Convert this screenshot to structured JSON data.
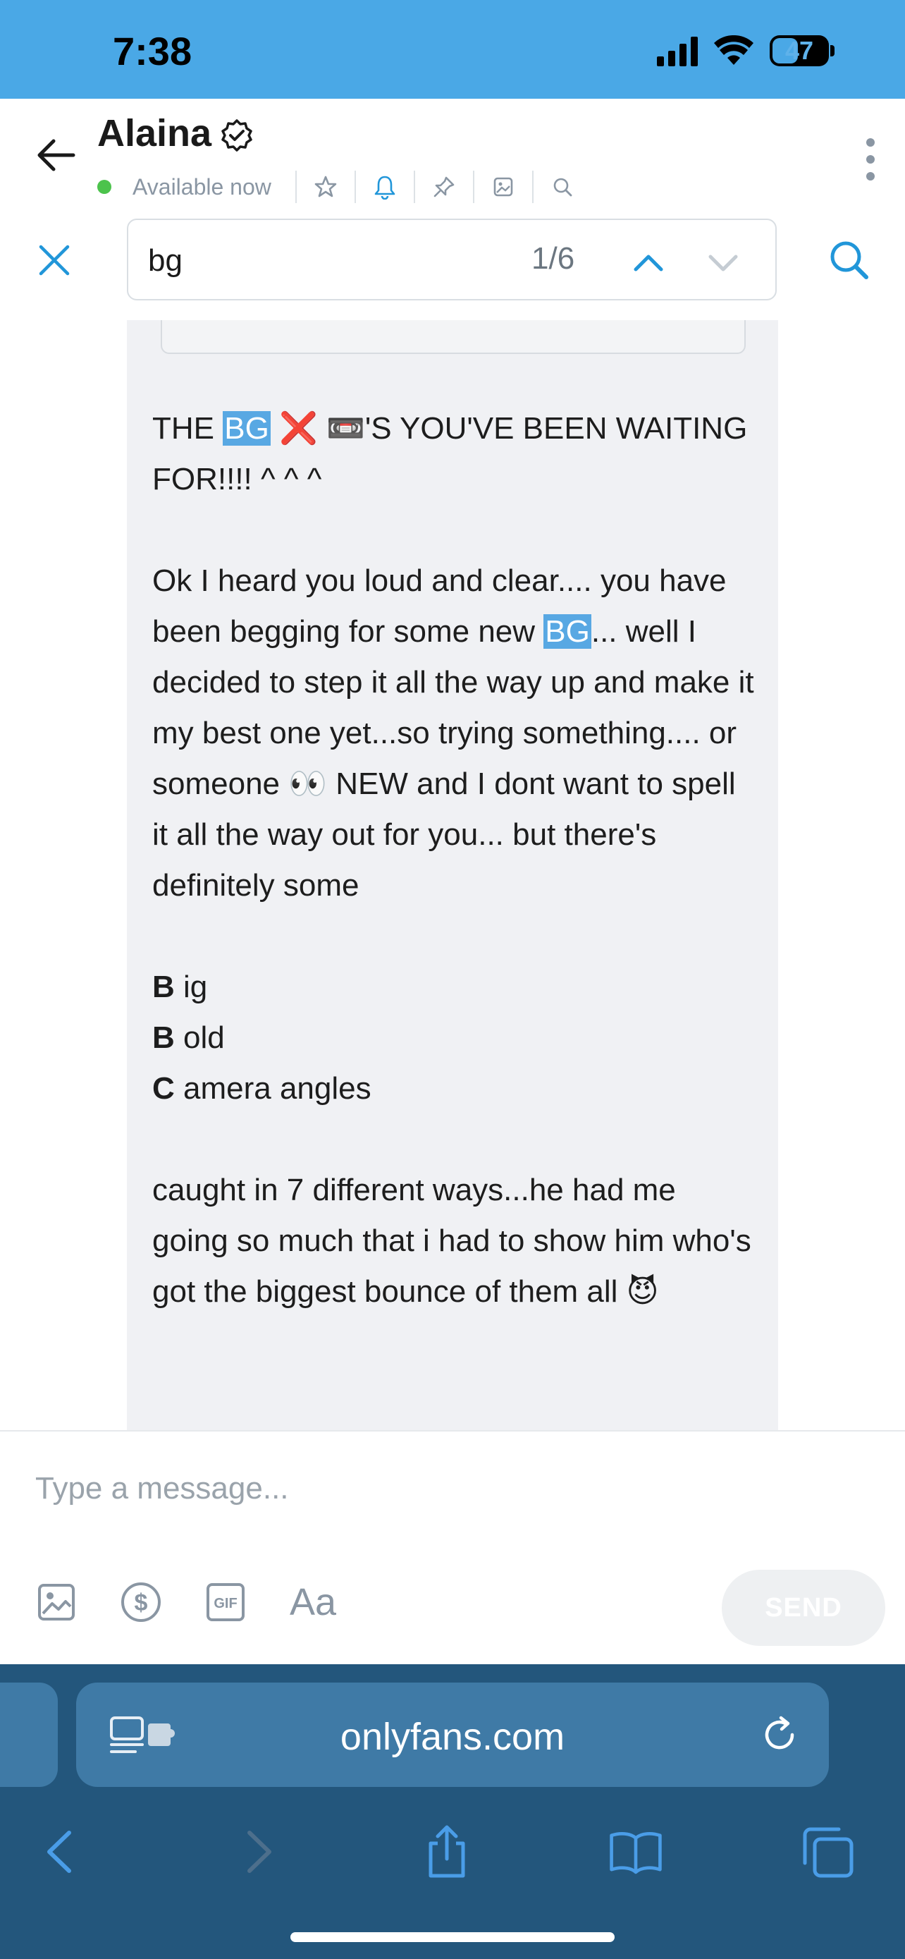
{
  "status_bar": {
    "time": "7:38",
    "battery": "47"
  },
  "header": {
    "contact_name": "Alaina",
    "presence": "Available now",
    "icons": [
      "star-icon",
      "bell-icon",
      "pin-icon",
      "image-icon",
      "search-icon"
    ]
  },
  "search": {
    "query": "bg",
    "count": "1/6"
  },
  "message": {
    "line1_pre": "THE ",
    "line1_hl": "BG",
    "line1_post": " ❌ 📼'S YOU'VE BEEN WAITING FOR!!!! ^ ^ ^",
    "para2_pre": "Ok I heard you loud and clear.... you have been begging for some new ",
    "para2_hl": "BG",
    "para2_post": "... well I decided to step it all the way up and make it my best one yet...so trying something.... or someone 👀 NEW and I dont want to spell it all the way out for you... but there's definitely some",
    "list": [
      {
        "letter": "B",
        "rest": " ig"
      },
      {
        "letter": "B",
        "rest": " old"
      },
      {
        "letter": "C",
        "rest": " amera angles"
      }
    ],
    "para4": "caught in 7 different ways...he had me going so much that i had to show him who's got the biggest bounce of them all 😈"
  },
  "composer": {
    "placeholder": "Type a message...",
    "aa_label": "Aa",
    "send_label": "SEND"
  },
  "browser": {
    "url": "onlyfans.com"
  },
  "colors": {
    "status_bar": "#4aa8e6",
    "accent": "#2196d9",
    "highlight": "#58a8e3",
    "bubble": "#f0f1f4",
    "browser": "#23567c"
  }
}
